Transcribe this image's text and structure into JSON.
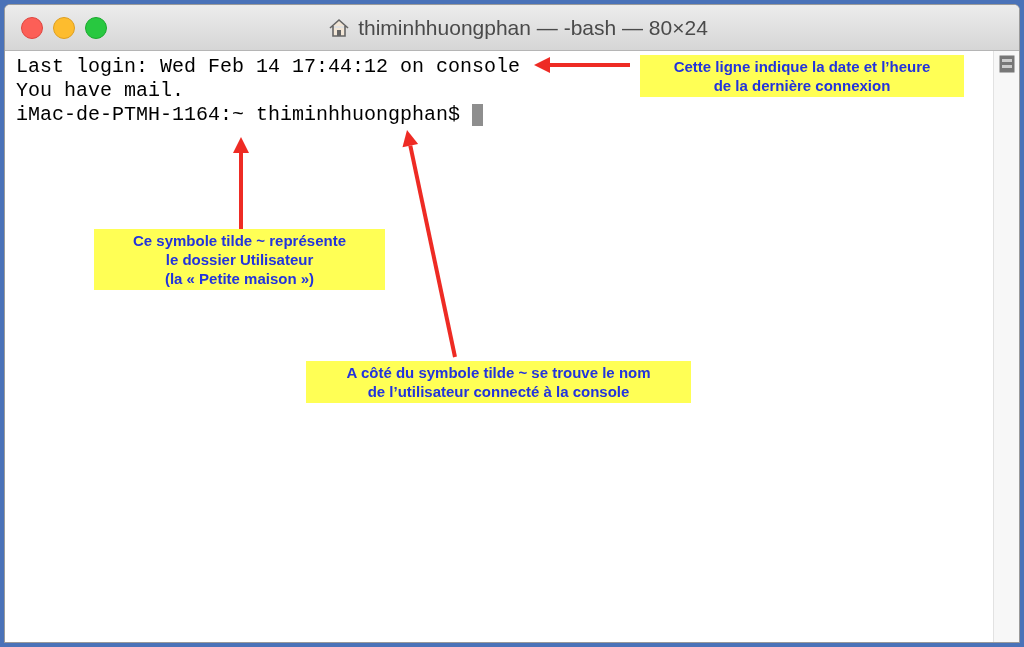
{
  "window": {
    "title": "thiminhhuongphan — -bash — 80×24"
  },
  "terminal": {
    "lines": [
      {
        "text": "Last login: Wed Feb 14 17:44:12 on console",
        "cursor": false
      },
      {
        "text": "You have mail.",
        "cursor": false
      },
      {
        "text": "iMac-de-PTMH-1164:~ thiminhhuongphan$ ",
        "cursor": true
      }
    ]
  },
  "annotations": [
    {
      "text": "Cette ligne indique la date et l’heure\nde la dernière connexion"
    },
    {
      "text": "Ce symbole tilde ~ représente\nle dossier Utilisateur\n(la « Petite maison »)"
    },
    {
      "text": "A côté du symbole tilde ~ se trouve le nom\nde l’utilisateur connecté à la console"
    }
  ]
}
